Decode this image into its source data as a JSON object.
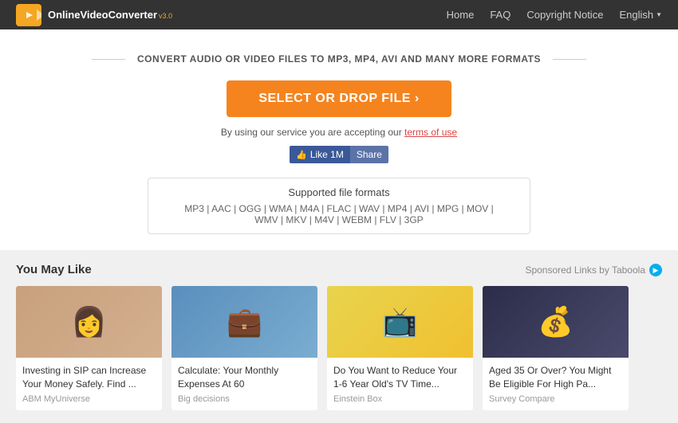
{
  "header": {
    "logo_text": "OnlineVideoConverter",
    "logo_version": "v3.0",
    "nav": {
      "home": "Home",
      "faq": "FAQ",
      "copyright": "Copyright Notice",
      "language": "English"
    }
  },
  "main": {
    "convert_label": "CONVERT AUDIO OR VIDEO FILES TO MP3, MP4, AVI AND MANY MORE FORMATS",
    "select_btn": "SELECT OR DROP FILE  ›",
    "terms_text": "By using our service you are accepting our",
    "terms_link": "terms of use",
    "fb_like": "Like 1M",
    "fb_share": "Share",
    "formats_title": "Supported file formats",
    "formats_list": "MP3 | AAC | OGG | WMA | M4A | FLAC | WAV | MP4 | AVI | MPG | MOV | WMV | MKV | M4V | WEBM | FLV | 3GP"
  },
  "recommendations": {
    "title": "You May Like",
    "sponsored": "Sponsored Links by Taboola",
    "cards": [
      {
        "title": "Investing in SIP can Increase Your Money Safely. Find ...",
        "source": "ABM MyUniverse",
        "emoji": "👩"
      },
      {
        "title": "Calculate: Your Monthly Expenses At 60",
        "source": "Big decisions",
        "emoji": "💼"
      },
      {
        "title": "Do You Want to Reduce Your 1-6 Year Old's TV Time...",
        "source": "Einstein Box",
        "emoji": "📺"
      },
      {
        "title": "Aged 35 Or Over? You Might Be Eligible For High Pa...",
        "source": "Survey Compare",
        "emoji": "💰"
      }
    ]
  }
}
